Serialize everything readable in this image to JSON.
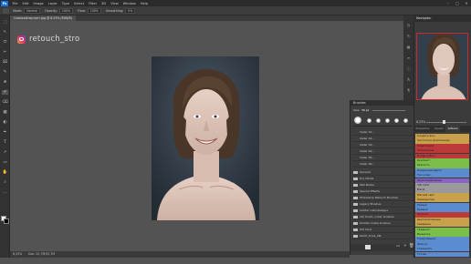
{
  "menubar": {
    "logo": "Ps",
    "items": [
      "File",
      "Edit",
      "Image",
      "Layer",
      "Type",
      "Select",
      "Filter",
      "3D",
      "View",
      "Window",
      "Help"
    ],
    "controls": [
      "–",
      "▢",
      "✕"
    ]
  },
  "options_bar": {
    "mode_label": "Mode:",
    "mode_value": "Normal",
    "opacity_label": "Opacity:",
    "opacity_value": "100%",
    "flow_label": "Flow:",
    "flow_value": "100%",
    "smoothing_label": "Smoothing:",
    "smoothing_value": "0%"
  },
  "document": {
    "tab_title": "Снимок#портрет.jpg @ 8,33% (RGB/8)",
    "status_zoom": "8,33%",
    "status_info": "Doc: 52,7M/52,7M"
  },
  "watermark": {
    "handle": "retouch_stro"
  },
  "tools": [
    "⬚",
    "↖",
    "⬭",
    "✂",
    "⌧",
    "✎",
    "⊗",
    "✐",
    "⌫",
    "▦",
    "◐",
    "✒",
    "T",
    "↗",
    "▭",
    "✋",
    "⌕",
    "…"
  ],
  "brush_panel": {
    "title": "Brushes",
    "size_label": "Size:",
    "size_value": "39 px",
    "brush_rows": [
      "Vader 01...",
      "Vader 02...",
      "Vader 03...",
      "Vader 04...",
      "Vader 05...",
      "Vader 06..."
    ],
    "folders": [
      "General",
      "Dry Media",
      "Wet Media",
      "Special Effects",
      "Photoshop Retouch Brushes",
      "Legacy Brushes",
      "Ladder naturalesque",
      "Lilli brush_nuber brushes",
      "Kristian mebe brushes",
      "UM hand",
      "Ketch_fores_2Ы"
    ]
  },
  "navigator": {
    "title": "Navigator",
    "zoom_value": "8,33%"
  },
  "actions_panel": {
    "tabs": [
      "Properties",
      "Layers",
      "Actions"
    ],
    "active_tab": "Actions",
    "buttons": [
      {
        "label": "Создать фон",
        "color": "#c9a14a"
      },
      {
        "label": "Частотное разложение",
        "color": "#c9a14a"
      },
      {
        "label": "Осветление",
        "color": "#bd3a3a"
      },
      {
        "label": "Затемнение",
        "color": "#bd3a3a"
      },
      {
        "label": "Dodge & Burn",
        "color": "#bd3a3a"
      },
      {
        "label": "Контраст",
        "color": "#7bbf4a"
      },
      {
        "label": "Резкость",
        "color": "#7bbf4a"
      },
      {
        "label": "Коррекция цвета",
        "color": "#5b8ccf"
      },
      {
        "label": "Тон кожи",
        "color": "#5b8ccf"
      },
      {
        "label": "Шумоподавление",
        "color": "#8a64c2"
      },
      {
        "label": "Ч/Б слой",
        "color": "#9a9a9a"
      },
      {
        "label": "Blend",
        "color": "#9a9a9a"
      },
      {
        "label": "Мягкий свет",
        "color": "#c9a14a"
      },
      {
        "label": "Перекрытие",
        "color": "#c9a14a"
      },
      {
        "label": "Уровни",
        "color": "#5b8ccf"
      },
      {
        "label": "Кривые",
        "color": "#5b8ccf"
      },
      {
        "label": "Экспорт",
        "color": "#bd3a3a"
      },
      {
        "label": "Цветовой баланс",
        "color": "#c9a14a"
      },
      {
        "label": "Сведение",
        "color": "#c9a14a"
      },
      {
        "label": "Градиент",
        "color": "#7bbf4a"
      },
      {
        "label": "Виньетка",
        "color": "#7bbf4a"
      },
      {
        "label": "Тонирование",
        "color": "#5b8ccf"
      },
      {
        "label": "Фильтр",
        "color": "#5b8ccf"
      },
      {
        "label": "Сохранить",
        "color": "#5b8ccf"
      },
      {
        "label": "Готово",
        "color": "#5b8ccf"
      }
    ]
  }
}
